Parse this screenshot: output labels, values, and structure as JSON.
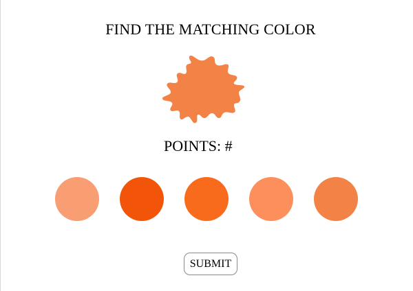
{
  "game": {
    "title": "FIND THE MATCHING COLOR",
    "points_label": "POINTS: #",
    "target_color": "#f28245",
    "swatches": [
      {
        "color": "#f99d72"
      },
      {
        "color": "#f25509"
      },
      {
        "color": "#f96b1c"
      },
      {
        "color": "#fc8f5b"
      },
      {
        "color": "#f28245"
      }
    ],
    "submit_label": "SUBMIT"
  }
}
